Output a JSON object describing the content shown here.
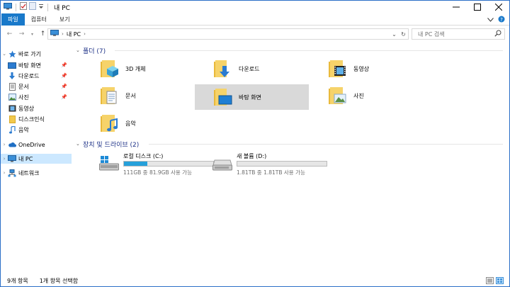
{
  "window": {
    "title": "내 PC"
  },
  "ribbon": {
    "tabs": [
      {
        "label": "파일"
      },
      {
        "label": "컴퓨터"
      },
      {
        "label": "보기"
      }
    ]
  },
  "address": {
    "crumb": "내 PC",
    "search_placeholder": "내 PC 검색"
  },
  "nav": {
    "quick_access": "바로 가기",
    "items": [
      {
        "label": "바탕 화면",
        "pinned": true
      },
      {
        "label": "다운로드",
        "pinned": true
      },
      {
        "label": "문서",
        "pinned": true
      },
      {
        "label": "사진",
        "pinned": true
      },
      {
        "label": "동영상",
        "pinned": false
      },
      {
        "label": "디스크인식",
        "pinned": false
      },
      {
        "label": "음악",
        "pinned": false
      }
    ],
    "onedrive": "OneDrive",
    "this_pc": "내 PC",
    "network": "네트워크"
  },
  "folders_group": {
    "title": "폴더 (7)",
    "items": [
      {
        "label": "3D 개체",
        "icon": "3d-objects-folder-icon"
      },
      {
        "label": "다운로드",
        "icon": "downloads-folder-icon"
      },
      {
        "label": "동영상",
        "icon": "videos-folder-icon"
      },
      {
        "label": "문서",
        "icon": "documents-folder-icon"
      },
      {
        "label": "바탕 화면",
        "icon": "desktop-folder-icon"
      },
      {
        "label": "사진",
        "icon": "pictures-folder-icon"
      },
      {
        "label": "음악",
        "icon": "music-folder-icon"
      }
    ]
  },
  "drives_group": {
    "title": "장치 및 드라이브 (2)",
    "items": [
      {
        "label": "로컬 디스크 (C:)",
        "usage": "111GB 중 81.9GB 사용 가능",
        "used_fraction": 0.26,
        "icon": "windows-drive-icon"
      },
      {
        "label": "새 볼륨 (D:)",
        "usage": "1.81TB 중 1.81TB 사용 가능",
        "used_fraction": 0.0,
        "icon": "hard-drive-icon"
      }
    ]
  },
  "status": {
    "item_count": "9개 항목",
    "selection": "1개 항목 선택함"
  },
  "colors": {
    "accent": "#1979ca",
    "group_header": "#1e3287",
    "folder_yellow": "#f2c94c",
    "selection": "#cce8ff",
    "drive_fill": "#26a0da"
  }
}
